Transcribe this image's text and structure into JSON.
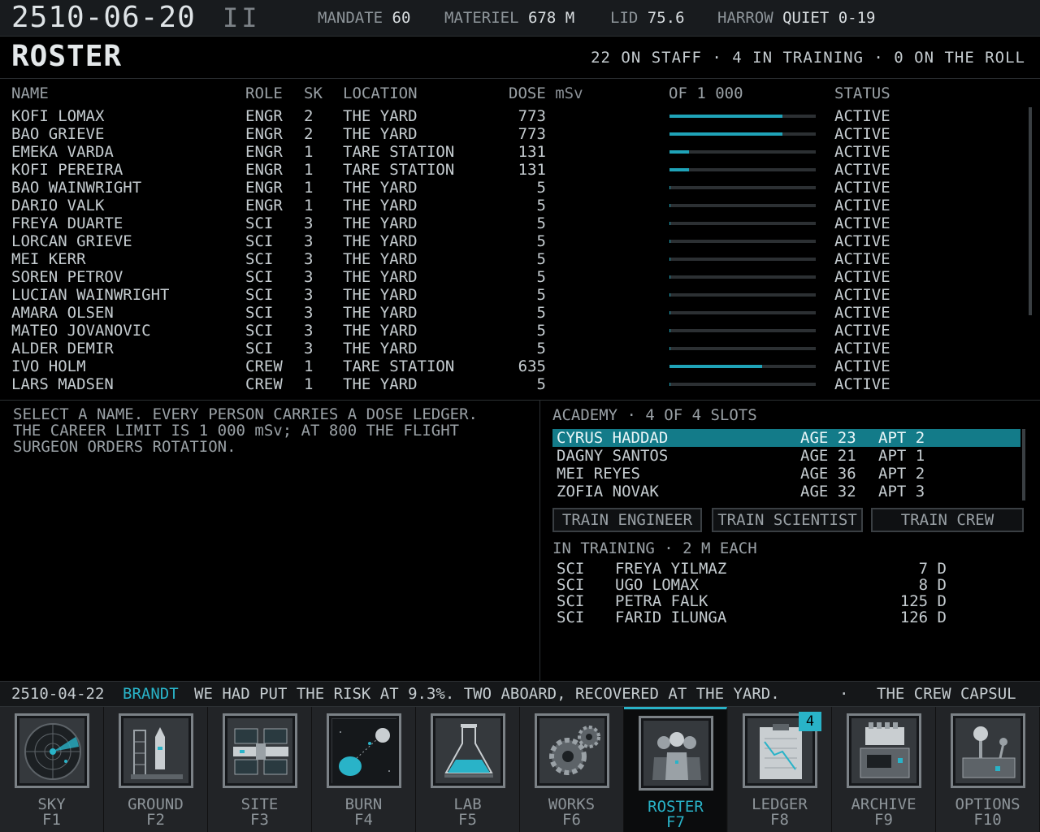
{
  "header": {
    "date": "2510-06-20",
    "speed": "II",
    "mandate_label": "MANDATE",
    "mandate_value": "60",
    "materiel_label": "MATERIEL",
    "materiel_value": "678 M",
    "lid_label": "LID",
    "lid_value": "75.6",
    "harrow_label": "HARROW",
    "harrow_value": "QUIET 0-19"
  },
  "page": {
    "title": "ROSTER",
    "staff_summary": "22 ON STAFF · 4 IN TRAINING · 0 ON THE ROLL"
  },
  "roster": {
    "columns": {
      "name": "NAME",
      "role": "ROLE",
      "sk": "SK",
      "location": "LOCATION",
      "dose": "DOSE",
      "dose_unit": "mSv",
      "limit": "OF 1 000",
      "status": "STATUS"
    },
    "dose_limit": 1000,
    "bar_color": "#1fa3b8",
    "rows": [
      {
        "name": "KOFI LOMAX",
        "role": "ENGR",
        "sk": "2",
        "location": "THE YARD",
        "dose": "773",
        "dose_value": 773,
        "status": "ACTIVE"
      },
      {
        "name": "BAO GRIEVE",
        "role": "ENGR",
        "sk": "2",
        "location": "THE YARD",
        "dose": "773",
        "dose_value": 773,
        "status": "ACTIVE"
      },
      {
        "name": "EMEKA VARDA",
        "role": "ENGR",
        "sk": "1",
        "location": "TARE STATION",
        "dose": "131",
        "dose_value": 131,
        "status": "ACTIVE"
      },
      {
        "name": "KOFI PEREIRA",
        "role": "ENGR",
        "sk": "1",
        "location": "TARE STATION",
        "dose": "131",
        "dose_value": 131,
        "status": "ACTIVE"
      },
      {
        "name": "BAO WAINWRIGHT",
        "role": "ENGR",
        "sk": "1",
        "location": "THE YARD",
        "dose": "5",
        "dose_value": 5,
        "status": "ACTIVE"
      },
      {
        "name": "DARIO VALK",
        "role": "ENGR",
        "sk": "1",
        "location": "THE YARD",
        "dose": "5",
        "dose_value": 5,
        "status": "ACTIVE"
      },
      {
        "name": "FREYA DUARTE",
        "role": "SCI",
        "sk": "3",
        "location": "THE YARD",
        "dose": "5",
        "dose_value": 5,
        "status": "ACTIVE"
      },
      {
        "name": "LORCAN GRIEVE",
        "role": "SCI",
        "sk": "3",
        "location": "THE YARD",
        "dose": "5",
        "dose_value": 5,
        "status": "ACTIVE"
      },
      {
        "name": "MEI KERR",
        "role": "SCI",
        "sk": "3",
        "location": "THE YARD",
        "dose": "5",
        "dose_value": 5,
        "status": "ACTIVE"
      },
      {
        "name": "SOREN PETROV",
        "role": "SCI",
        "sk": "3",
        "location": "THE YARD",
        "dose": "5",
        "dose_value": 5,
        "status": "ACTIVE"
      },
      {
        "name": "LUCIAN WAINWRIGHT",
        "role": "SCI",
        "sk": "3",
        "location": "THE YARD",
        "dose": "5",
        "dose_value": 5,
        "status": "ACTIVE"
      },
      {
        "name": "AMARA OLSEN",
        "role": "SCI",
        "sk": "3",
        "location": "THE YARD",
        "dose": "5",
        "dose_value": 5,
        "status": "ACTIVE"
      },
      {
        "name": "MATEO JOVANOVIC",
        "role": "SCI",
        "sk": "3",
        "location": "THE YARD",
        "dose": "5",
        "dose_value": 5,
        "status": "ACTIVE"
      },
      {
        "name": "ALDER DEMIR",
        "role": "SCI",
        "sk": "3",
        "location": "THE YARD",
        "dose": "5",
        "dose_value": 5,
        "status": "ACTIVE"
      },
      {
        "name": "IVO HOLM",
        "role": "CREW",
        "sk": "1",
        "location": "TARE STATION",
        "dose": "635",
        "dose_value": 635,
        "status": "ACTIVE"
      },
      {
        "name": "LARS MADSEN",
        "role": "CREW",
        "sk": "1",
        "location": "THE YARD",
        "dose": "5",
        "dose_value": 5,
        "status": "ACTIVE"
      }
    ]
  },
  "help": {
    "lines": [
      "SELECT A NAME. EVERY PERSON CARRIES A DOSE LEDGER.",
      "THE CAREER LIMIT IS 1 000 mSv; AT 800 THE FLIGHT",
      "SURGEON ORDERS ROTATION."
    ]
  },
  "academy": {
    "title": "ACADEMY · 4 OF 4 SLOTS",
    "candidates": [
      {
        "name": "CYRUS HADDAD",
        "age": "AGE 23",
        "apt": "APT 2",
        "selected": true
      },
      {
        "name": "DAGNY SANTOS",
        "age": "AGE 21",
        "apt": "APT 1",
        "selected": false
      },
      {
        "name": "MEI REYES",
        "age": "AGE 36",
        "apt": "APT 2",
        "selected": false
      },
      {
        "name": "ZOFIA NOVAK",
        "age": "AGE 32",
        "apt": "APT 3",
        "selected": false
      }
    ],
    "buttons": {
      "train_engineer": "TRAIN ENGINEER",
      "train_scientist": "TRAIN SCIENTIST",
      "train_crew": "TRAIN CREW"
    }
  },
  "training": {
    "title": "IN TRAINING · 2 M EACH",
    "rows": [
      {
        "role": "SCI",
        "name": "FREYA YILMAZ",
        "days": "7 D"
      },
      {
        "role": "SCI",
        "name": "UGO LOMAX",
        "days": "8 D"
      },
      {
        "role": "SCI",
        "name": "PETRA FALK",
        "days": "125 D"
      },
      {
        "role": "SCI",
        "name": "FARID ILUNGA",
        "days": "126 D"
      }
    ]
  },
  "ticker": {
    "date": "2510-04-22",
    "speaker": "BRANDT",
    "message": "WE HAD PUT THE RISK AT 9.3%. TWO ABOARD, RECOVERED AT THE YARD.",
    "separator": "·",
    "next": "THE CREW CAPSUL"
  },
  "nav": {
    "items": [
      {
        "label": "SKY",
        "key": "F1",
        "icon": "radar-icon",
        "active": false
      },
      {
        "label": "GROUND",
        "key": "F2",
        "icon": "launch-pad-icon",
        "active": false
      },
      {
        "label": "SITE",
        "key": "F3",
        "icon": "station-icon",
        "active": false
      },
      {
        "label": "BURN",
        "key": "F4",
        "icon": "orbit-icon",
        "active": false
      },
      {
        "label": "LAB",
        "key": "F5",
        "icon": "flask-icon",
        "active": false
      },
      {
        "label": "WORKS",
        "key": "F6",
        "icon": "gears-icon",
        "active": false
      },
      {
        "label": "ROSTER",
        "key": "F7",
        "icon": "people-icon",
        "active": true
      },
      {
        "label": "LEDGER",
        "key": "F8",
        "icon": "clipboard-chart-icon",
        "active": false,
        "badge": "4"
      },
      {
        "label": "ARCHIVE",
        "key": "F9",
        "icon": "archive-machine-icon",
        "active": false
      },
      {
        "label": "OPTIONS",
        "key": "F10",
        "icon": "joystick-icon",
        "active": false
      }
    ]
  }
}
